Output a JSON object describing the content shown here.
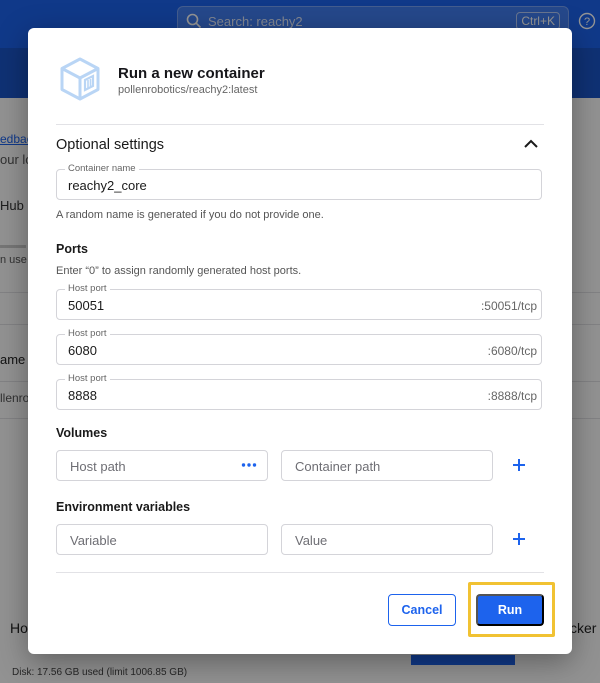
{
  "app": {
    "search_placeholder": "Search: reachy2",
    "search_shortcut": "Ctrl+K",
    "bg_texts": {
      "feedback": "edback",
      "your_lo": "our lo",
      "hub_re": "Hub re",
      "in_use": "n use",
      "name": "ame",
      "pollenro": "llenro",
      "ho": "Ho",
      "cker": "cker",
      "disk": "Disk: 17.56 GB used (limit 1006.85 GB)"
    }
  },
  "dialog": {
    "title": "Run a new container",
    "subtitle": "pollenrobotics/reachy2:latest",
    "optional_settings": "Optional settings",
    "container_name": {
      "label": "Container name",
      "value": "reachy2_core",
      "helper": "A random name is generated if you do not provide one."
    },
    "ports": {
      "title": "Ports",
      "helper": "Enter “0” to assign randomly generated host ports.",
      "items": [
        {
          "label": "Host port",
          "value": "50051",
          "suffix": ":50051/tcp"
        },
        {
          "label": "Host port",
          "value": "6080",
          "suffix": ":6080/tcp"
        },
        {
          "label": "Host port",
          "value": "8888",
          "suffix": ":8888/tcp"
        }
      ]
    },
    "volumes": {
      "title": "Volumes",
      "host_path_placeholder": "Host path",
      "container_path_placeholder": "Container path"
    },
    "env": {
      "title": "Environment variables",
      "variable_placeholder": "Variable",
      "value_placeholder": "Value"
    },
    "cancel_label": "Cancel",
    "run_label": "Run"
  },
  "colors": {
    "accent": "#1d63ed",
    "highlight": "#f1c232"
  }
}
